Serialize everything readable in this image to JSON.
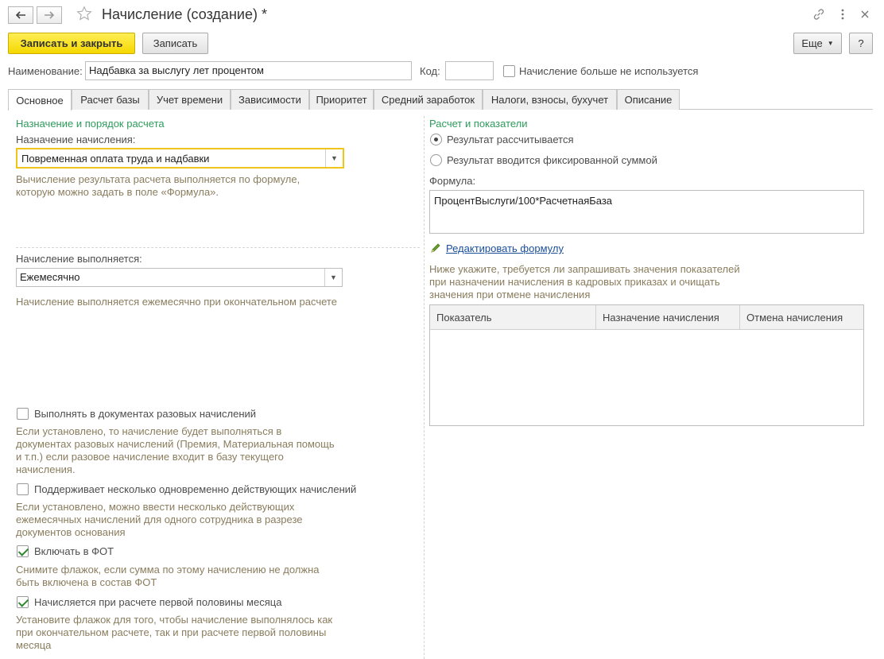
{
  "window": {
    "title": "Начисление (создание) *"
  },
  "toolbar": {
    "save_close": "Записать и закрыть",
    "save": "Записать",
    "more": "Еще",
    "help": "?"
  },
  "header": {
    "name_label": "Наименование:",
    "name_value": "Надбавка за выслугу лет процентом",
    "code_label": "Код:",
    "code_value": "",
    "unused_label": "Начисление больше не используется"
  },
  "tabs": [
    {
      "label": "Основное"
    },
    {
      "label": "Расчет базы"
    },
    {
      "label": "Учет времени"
    },
    {
      "label": "Зависимости"
    },
    {
      "label": "Приоритет"
    },
    {
      "label": "Средний заработок"
    },
    {
      "label": "Налоги, взносы, бухучет"
    },
    {
      "label": "Описание"
    }
  ],
  "left": {
    "section_title": "Назначение и порядок расчета",
    "purpose_label": "Назначение начисления:",
    "purpose_value": "Повременная оплата труда и надбавки",
    "purpose_hint_1": "Вычисление результата расчета выполняется по формуле,",
    "purpose_hint_2": "которую можно задать в поле «Формула».",
    "performed_label": "Начисление выполняется:",
    "performed_value": "Ежемесячно",
    "performed_hint": "Начисление выполняется ежемесячно при окончательном расчете",
    "options": [
      {
        "label": "Выполнять в документах разовых начислений",
        "checked": false,
        "hint": [
          "Если установлено, то начисление будет выполняться в",
          "документах разовых начислений (Премия, Материальная помощь",
          "и т.п.) если разовое начисление входит в базу текущего",
          "начисления."
        ]
      },
      {
        "label": "Поддерживает несколько одновременно действующих начислений",
        "checked": false,
        "hint": [
          "Если установлено, можно ввести несколько действующих",
          "ежемесячных начислений для одного сотрудника в разрезе",
          "документов основания"
        ]
      },
      {
        "label": "Включать в ФОТ",
        "checked": true,
        "hint": [
          "Снимите флажок, если сумма по этому начислению не должна",
          "быть включена в состав ФОТ"
        ]
      },
      {
        "label": "Начисляется при расчете первой половины месяца",
        "checked": true,
        "hint": [
          "Установите флажок для того, чтобы начисление выполнялось как",
          "при окончательном расчете, так и при расчете первой половины",
          "месяца"
        ]
      }
    ]
  },
  "right": {
    "section_title": "Расчет и показатели",
    "radio_calculated": "Результат рассчитывается",
    "radio_fixed": "Результат вводится фиксированной суммой",
    "formula_label": "Формула:",
    "formula_value": "ПроцентВыслуги/100*РасчетнаяБаза",
    "edit_formula_link": "Редактировать формулу",
    "indicators_hint_1": "Ниже укажите, требуется ли запрашивать значения показателей",
    "indicators_hint_2": "при назначении начисления в кадровых приказах и очищать",
    "indicators_hint_3": "значения при отмене начисления",
    "table_columns": [
      "Показатель",
      "Назначение начисления",
      "Отмена начисления"
    ]
  },
  "colors": {
    "primary_button": "#f5d800",
    "section_title": "#2e9c5c",
    "hint_text": "#8a7d5e",
    "focus_border": "#f0c419",
    "link": "#1a4f9c"
  }
}
